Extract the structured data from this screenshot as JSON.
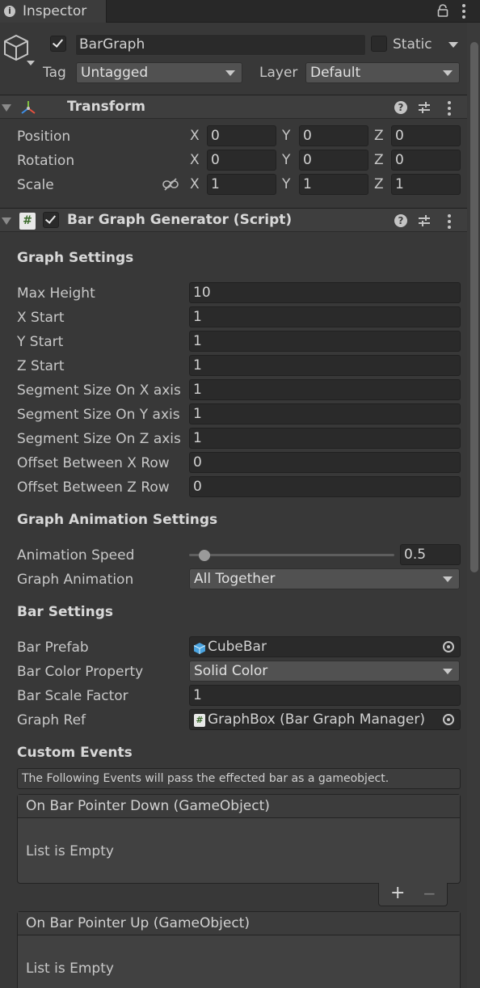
{
  "tab": {
    "title": "Inspector"
  },
  "object": {
    "name": "BarGraph",
    "static_label": "Static",
    "tag_label": "Tag",
    "tag_value": "Untagged",
    "layer_label": "Layer",
    "layer_value": "Default"
  },
  "transform": {
    "title": "Transform",
    "position": {
      "label": "Position",
      "x": "0",
      "y": "0",
      "z": "0"
    },
    "rotation": {
      "label": "Rotation",
      "x": "0",
      "y": "0",
      "z": "0"
    },
    "scale": {
      "label": "Scale",
      "x": "1",
      "y": "1",
      "z": "1"
    },
    "axis": {
      "x": "X",
      "y": "Y",
      "z": "Z"
    }
  },
  "script": {
    "title": "Bar Graph Generator (Script)",
    "graph_settings": {
      "title": "Graph Settings",
      "max_height": {
        "label": "Max Height",
        "value": "10"
      },
      "x_start": {
        "label": "X Start",
        "value": "1"
      },
      "y_start": {
        "label": "Y Start",
        "value": "1"
      },
      "z_start": {
        "label": "Z Start",
        "value": "1"
      },
      "seg_x": {
        "label": "Segment Size On X axis",
        "value": "1"
      },
      "seg_y": {
        "label": "Segment Size On Y axis",
        "value": "1"
      },
      "seg_z": {
        "label": "Segment Size On Z axis",
        "value": "1"
      },
      "offset_x": {
        "label": "Offset Between X Row",
        "value": "0"
      },
      "offset_z": {
        "label": "Offset Between Z Row",
        "value": "0"
      }
    },
    "anim_settings": {
      "title": "Graph Animation Settings",
      "speed": {
        "label": "Animation Speed",
        "value": "0.5",
        "slider_fraction": 0.05
      },
      "animation": {
        "label": "Graph Animation",
        "value": "All Together"
      }
    },
    "bar_settings": {
      "title": "Bar Settings",
      "prefab": {
        "label": "Bar Prefab",
        "value": "CubeBar"
      },
      "color_property": {
        "label": "Bar Color Property",
        "value": "Solid Color"
      },
      "scale_factor": {
        "label": "Bar Scale Factor",
        "value": "1"
      },
      "graph_ref": {
        "label": "Graph Ref",
        "value": "GraphBox (Bar Graph Manager)"
      }
    },
    "custom_events": {
      "title": "Custom Events",
      "help_text": "The Following Events will pass the effected bar as a gameobject.",
      "events": [
        {
          "header": "On Bar Pointer Down (GameObject)",
          "empty": "List is Empty"
        },
        {
          "header": "On Bar Pointer Up (GameObject)",
          "empty": "List is Empty"
        }
      ],
      "add": "+",
      "remove": "−"
    }
  },
  "colors": {
    "bg": "#383838",
    "field": "#2a2a2a",
    "header": "#3e3e3e",
    "dropdown": "#515151"
  }
}
